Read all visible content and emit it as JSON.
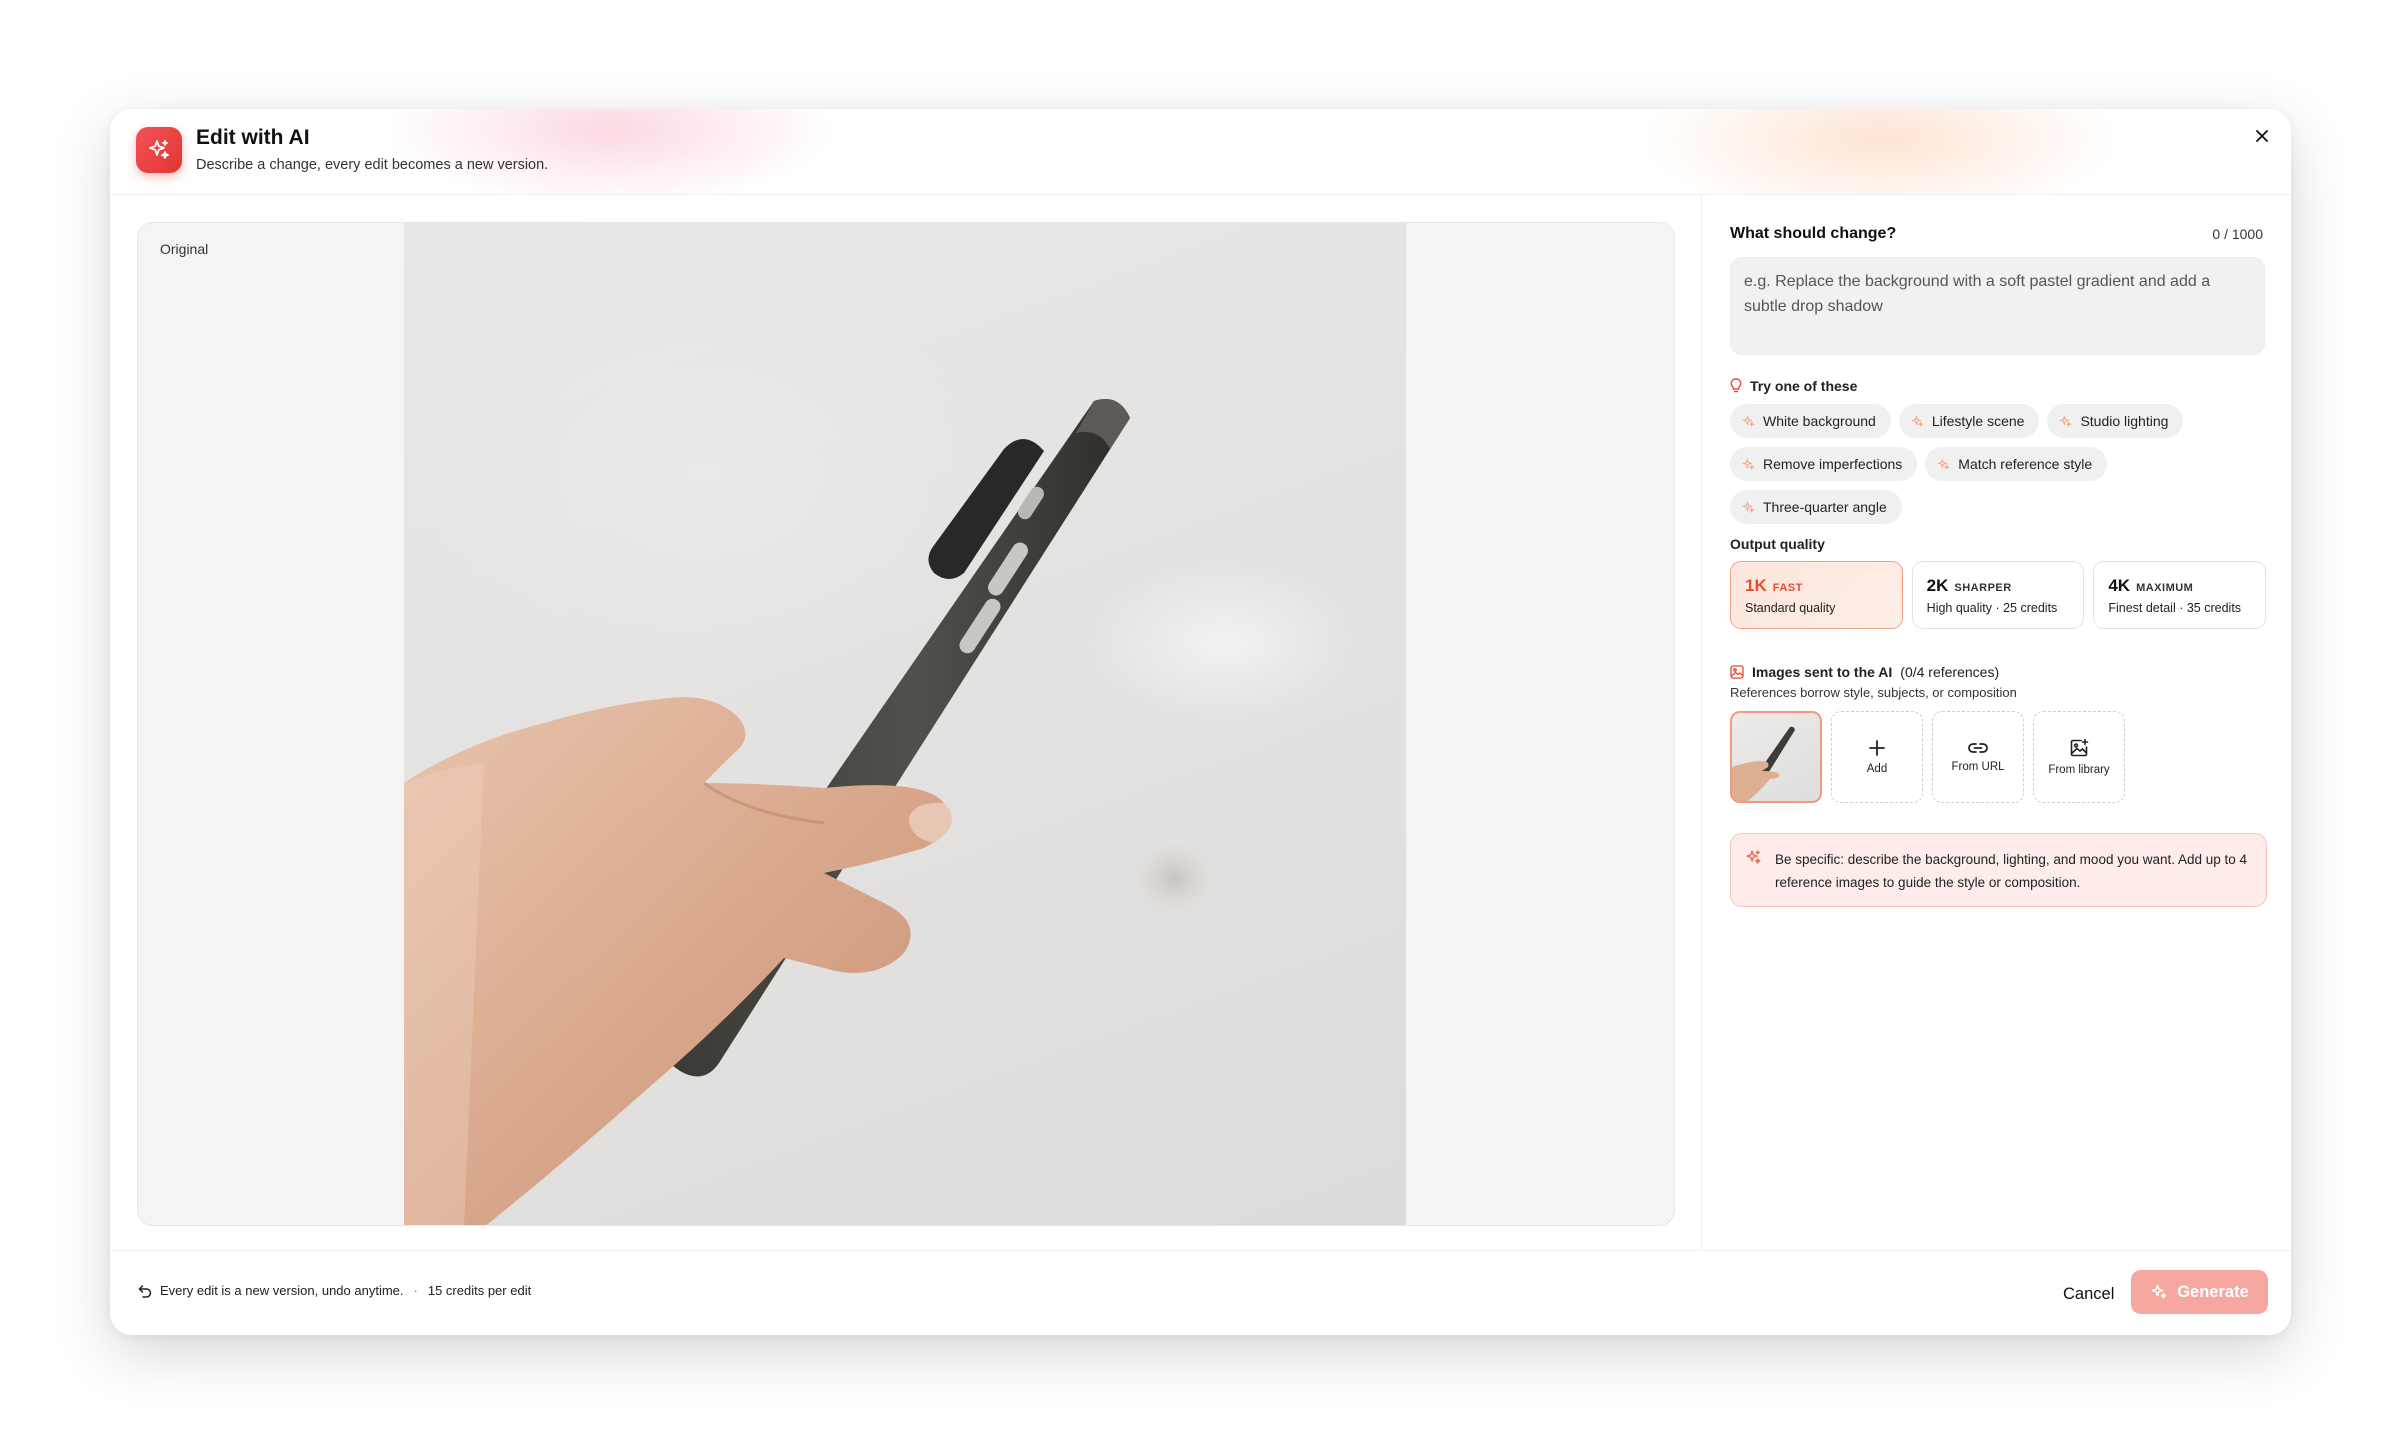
{
  "header": {
    "title": "Edit with AI",
    "subtitle": "Describe a change, every edit becomes a new version.",
    "icon": "sparkles-icon",
    "close_icon": "close-icon"
  },
  "canvas": {
    "label": "Original"
  },
  "prompt": {
    "label": "What should change?",
    "char_count": "0 / 1000",
    "value": "",
    "placeholder": "e.g. Replace the background with a soft pastel gradient and add a subtle drop shadow"
  },
  "suggestions": {
    "title": "Try one of these",
    "chips": [
      "White background",
      "Lifestyle scene",
      "Studio lighting",
      "Remove imperfections",
      "Match reference style",
      "Three-quarter angle"
    ]
  },
  "quality": {
    "label": "Output quality",
    "options": [
      {
        "res": "1K",
        "tag": "FAST",
        "desc": "Standard quality",
        "selected": true
      },
      {
        "res": "2K",
        "tag": "SHARPER",
        "desc": "High quality · 25 credits",
        "selected": false
      },
      {
        "res": "4K",
        "tag": "MAXIMUM",
        "desc": "Finest detail · 35 credits",
        "selected": false
      }
    ]
  },
  "references": {
    "title": "Images sent to the AI",
    "count": "(0/4 references)",
    "subtitle": "References borrow style, subjects, or composition",
    "add_label": "Add",
    "url_label": "From URL",
    "library_label": "From library"
  },
  "tip": {
    "text": "Be specific: describe the background, lighting, and mood you want. Add up to 4 reference images to guide the style or composition."
  },
  "footer": {
    "note": "Every edit is a new version, undo anytime.",
    "separator": "·",
    "credits": "15 credits per edit",
    "cancel_label": "Cancel",
    "generate_label": "Generate"
  },
  "colors": {
    "accent": "#ea4a2e",
    "generate_button": "#f6a7a0",
    "tip_background": "#fdecea"
  }
}
